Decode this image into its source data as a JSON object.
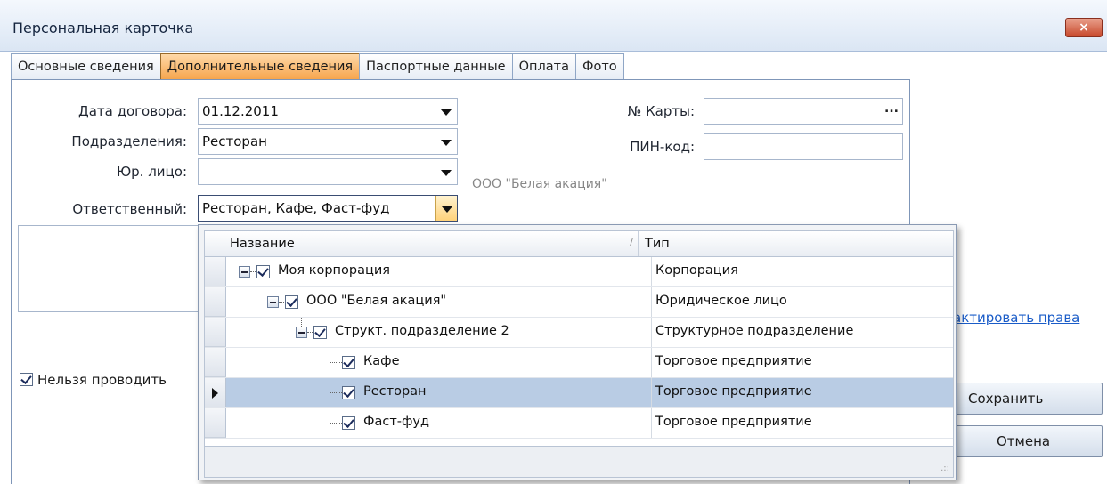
{
  "window": {
    "title": "Персональная карточка",
    "close_glyph": "×",
    "close_icon": "close-icon"
  },
  "tabs": [
    {
      "label": "Основные сведения",
      "active": false
    },
    {
      "label": "Дополнительные сведения",
      "active": true
    },
    {
      "label": "Паспортные данные",
      "active": false
    },
    {
      "label": "Оплата",
      "active": false
    },
    {
      "label": "Фото",
      "active": false
    }
  ],
  "form": {
    "contract_date": {
      "label": "Дата договора:",
      "value": "01.12.2011"
    },
    "departments": {
      "label": "Подразделения:",
      "value": "Ресторан"
    },
    "legal_entity": {
      "label": "Юр. лицо:",
      "value": "",
      "hint": "ООО \"Белая акация\""
    },
    "responsible": {
      "label": "Ответственный:",
      "value": "Ресторан, Кафе, Фаст-фуд"
    },
    "card_number": {
      "label": "№ Карты:",
      "value": "",
      "button": "..."
    },
    "pin_code": {
      "label": "ПИН-код:",
      "value": ""
    }
  },
  "checkbox_no_post": {
    "label": "Нельзя проводить",
    "checked": true
  },
  "edit_rights_link": "актировать права",
  "buttons": {
    "save": "Сохранить",
    "cancel": "Отмена"
  },
  "popup": {
    "columns": {
      "name": "Название",
      "type": "Тип",
      "sort_mark": "/"
    },
    "rows": [
      {
        "name": "Моя корпорация",
        "type": "Корпорация",
        "level": 0,
        "checked": true,
        "expander": true,
        "selected": false
      },
      {
        "name": "ООО \"Белая акация\"",
        "type": "Юридическое лицо",
        "level": 1,
        "checked": true,
        "expander": true,
        "selected": false
      },
      {
        "name": "Структ. подразделение 2",
        "type": "Структурное подразделение",
        "level": 2,
        "checked": true,
        "expander": true,
        "selected": false
      },
      {
        "name": "Кафе",
        "type": "Торговое предприятие",
        "level": 3,
        "checked": true,
        "expander": false,
        "selected": false
      },
      {
        "name": "Ресторан",
        "type": "Торговое предприятие",
        "level": 3,
        "checked": true,
        "expander": false,
        "selected": true
      },
      {
        "name": "Фаст-фуд",
        "type": "Торговое предприятие",
        "level": 3,
        "checked": true,
        "expander": false,
        "selected": false
      }
    ],
    "grip": ".::"
  },
  "colors": {
    "accent_tab": "#f6a34a",
    "selection": "#b9cce4",
    "link": "#1a5cc8"
  }
}
